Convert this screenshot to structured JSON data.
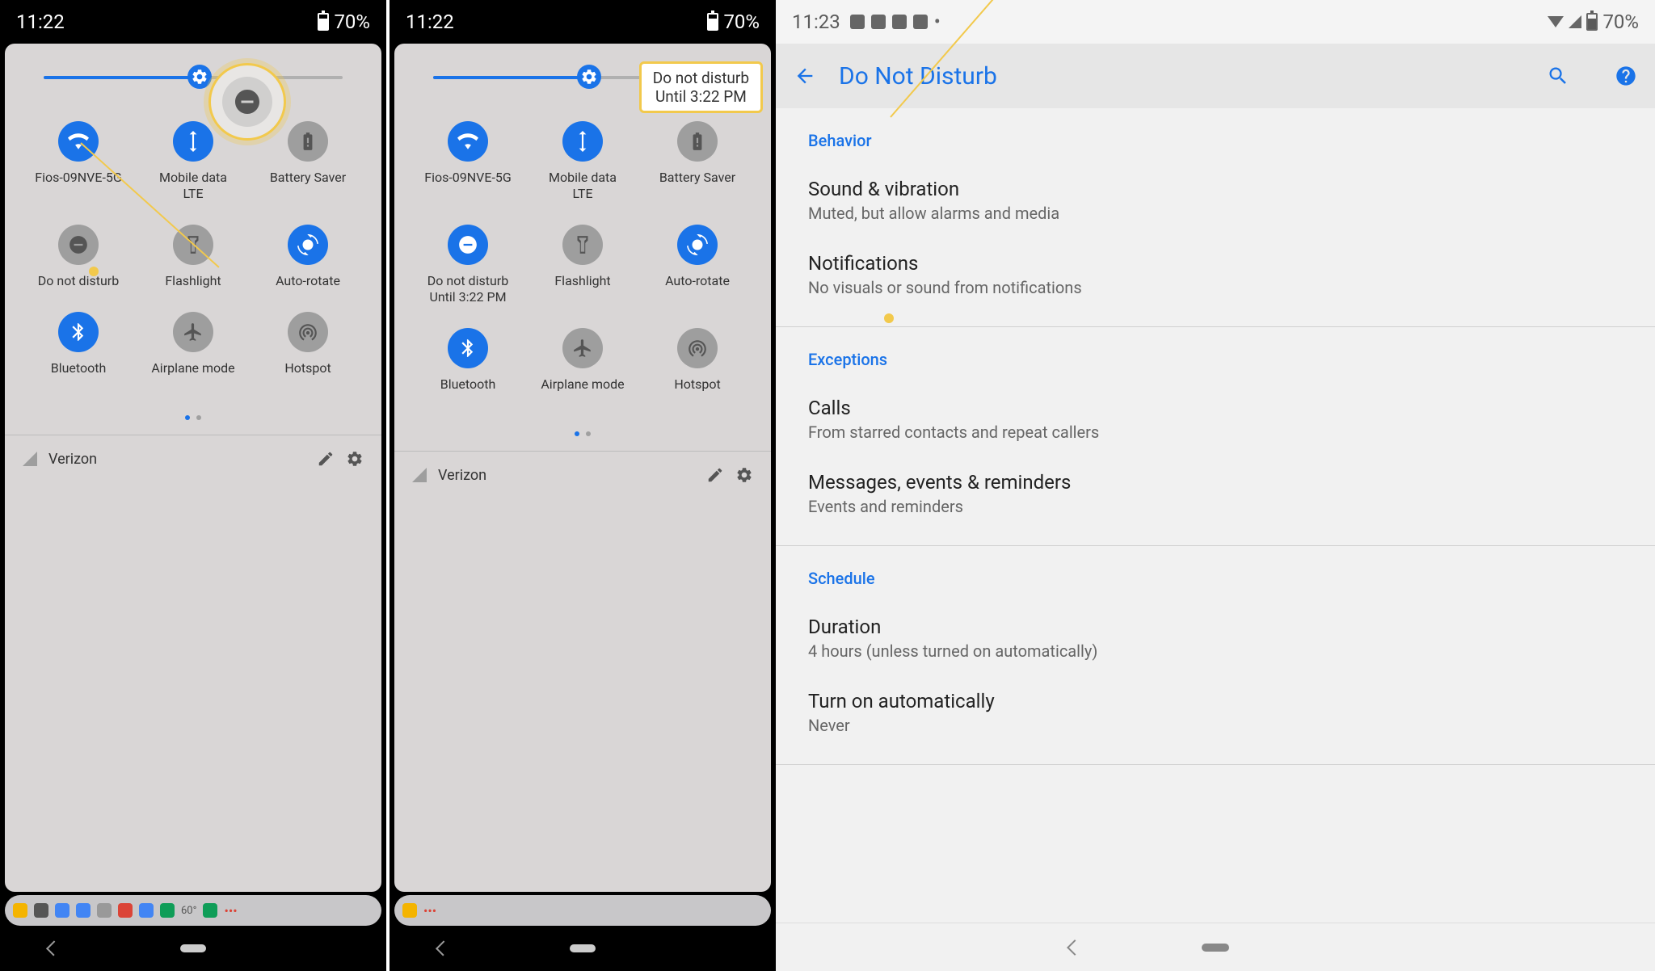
{
  "phone1": {
    "status": {
      "time": "11:22",
      "battery": "70%"
    },
    "tiles": [
      {
        "label": "Fios-09NVE-5G",
        "sub": "",
        "icon": "wifi",
        "active": true
      },
      {
        "label": "Mobile data",
        "sub": "LTE",
        "icon": "data",
        "active": true
      },
      {
        "label": "Battery Saver",
        "sub": "",
        "icon": "battery",
        "active": false
      },
      {
        "label": "Do not disturb",
        "sub": "",
        "icon": "dnd",
        "active": false
      },
      {
        "label": "Flashlight",
        "sub": "",
        "icon": "flashlight",
        "active": false
      },
      {
        "label": "Auto-rotate",
        "sub": "",
        "icon": "rotate",
        "active": true
      },
      {
        "label": "Bluetooth",
        "sub": "",
        "icon": "bluetooth",
        "active": true
      },
      {
        "label": "Airplane mode",
        "sub": "",
        "icon": "airplane",
        "active": false
      },
      {
        "label": "Hotspot",
        "sub": "",
        "icon": "hotspot",
        "active": false
      }
    ],
    "carrier": "Verizon",
    "weather": "60°"
  },
  "phone2": {
    "status": {
      "time": "11:22",
      "battery": "70%"
    },
    "tiles": [
      {
        "label": "Fios-09NVE-5G",
        "sub": "",
        "icon": "wifi",
        "active": true
      },
      {
        "label": "Mobile data",
        "sub": "LTE",
        "icon": "data",
        "active": true
      },
      {
        "label": "Battery Saver",
        "sub": "",
        "icon": "battery",
        "active": false
      },
      {
        "label": "Do not disturb",
        "sub": "Until 3:22 PM",
        "icon": "dnd",
        "active": true
      },
      {
        "label": "Flashlight",
        "sub": "",
        "icon": "flashlight",
        "active": false
      },
      {
        "label": "Auto-rotate",
        "sub": "",
        "icon": "rotate",
        "active": true
      },
      {
        "label": "Bluetooth",
        "sub": "",
        "icon": "bluetooth",
        "active": true
      },
      {
        "label": "Airplane mode",
        "sub": "",
        "icon": "airplane",
        "active": false
      },
      {
        "label": "Hotspot",
        "sub": "",
        "icon": "hotspot",
        "active": false
      }
    ],
    "carrier": "Verizon",
    "callout": {
      "line1": "Do not disturb",
      "line2": "Until 3:22 PM"
    }
  },
  "phone3": {
    "status": {
      "time": "11:23",
      "battery": "70%"
    },
    "title": "Do Not Disturb",
    "sections": [
      {
        "header": "Behavior",
        "items": [
          {
            "title": "Sound & vibration",
            "sub": "Muted, but allow alarms and media"
          },
          {
            "title": "Notifications",
            "sub": "No visuals or sound from notifications"
          }
        ]
      },
      {
        "header": "Exceptions",
        "items": [
          {
            "title": "Calls",
            "sub": "From starred contacts and repeat callers"
          },
          {
            "title": "Messages, events & reminders",
            "sub": "Events and reminders"
          }
        ]
      },
      {
        "header": "Schedule",
        "items": [
          {
            "title": "Duration",
            "sub": "4 hours (unless turned on automatically)"
          },
          {
            "title": "Turn on automatically",
            "sub": "Never"
          }
        ]
      }
    ]
  }
}
